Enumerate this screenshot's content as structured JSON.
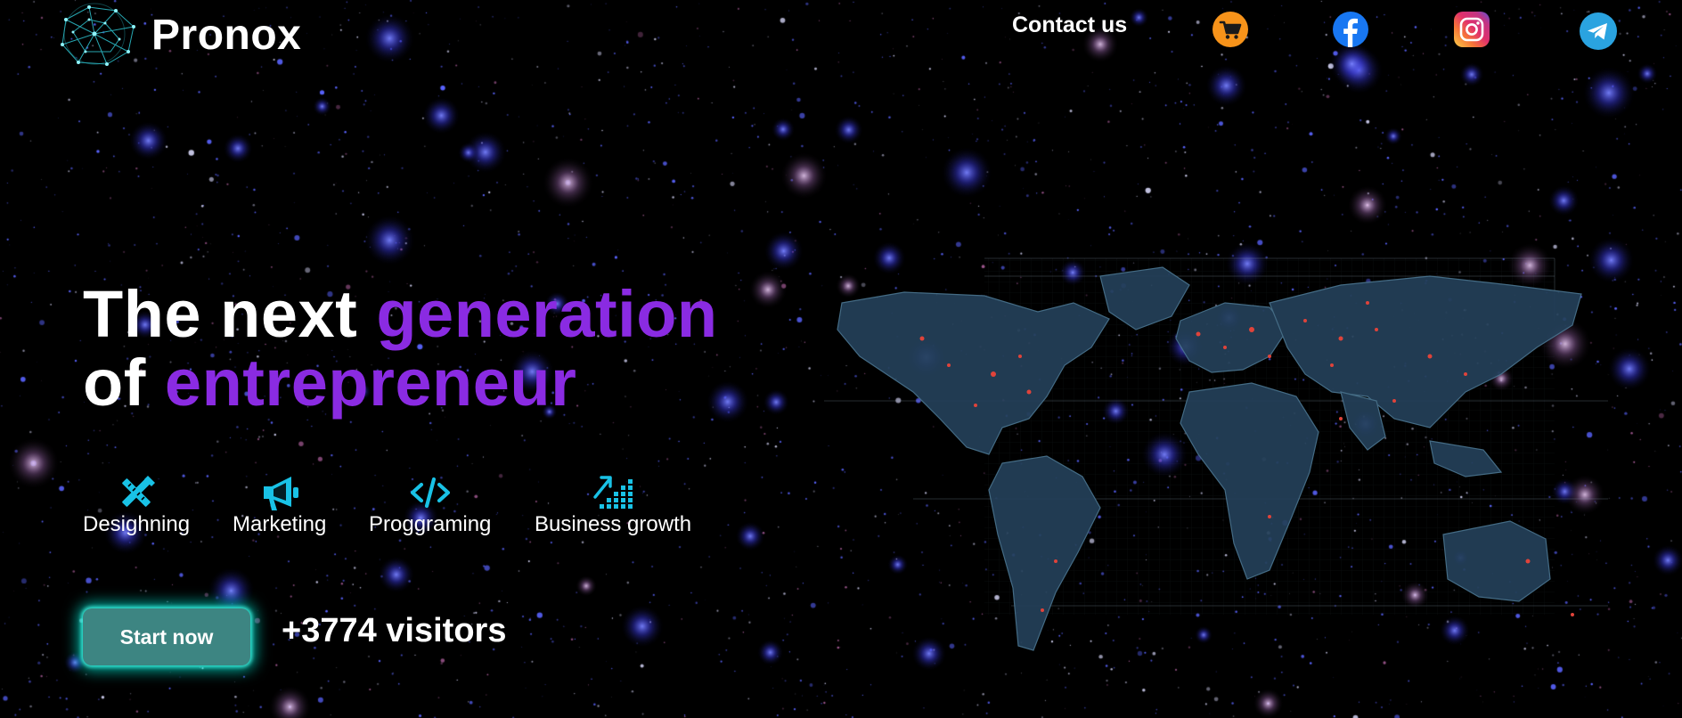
{
  "header": {
    "brand": "Pronox",
    "contact_label": "Contact us",
    "social": [
      {
        "icon": "cart-icon",
        "color": "#f7931a"
      },
      {
        "icon": "facebook-icon",
        "color": "#1877f2"
      },
      {
        "icon": "instagram-icon",
        "color": "#d6249f"
      },
      {
        "icon": "telegram-icon",
        "color": "#2aa3e0"
      }
    ]
  },
  "hero": {
    "line1_plain": "The next",
    "line1_accent": "generation",
    "line2_plain": "of",
    "line2_accent": "entrepreneur"
  },
  "services": [
    {
      "icon": "design-tools-icon",
      "label": "Desighning"
    },
    {
      "icon": "megaphone-icon",
      "label": "Marketing"
    },
    {
      "icon": "code-icon",
      "label": "Proggraming"
    },
    {
      "icon": "growth-chart-icon",
      "label": "Business growth"
    }
  ],
  "cta": {
    "start_label": "Start now",
    "visitors_text": "+3774 visitors"
  },
  "colors": {
    "accent_purple": "#8a2be2",
    "icon_cyan": "#19c2e6",
    "button_teal": "#3d8582",
    "glow": "#00ebd7",
    "background": "#000000"
  }
}
